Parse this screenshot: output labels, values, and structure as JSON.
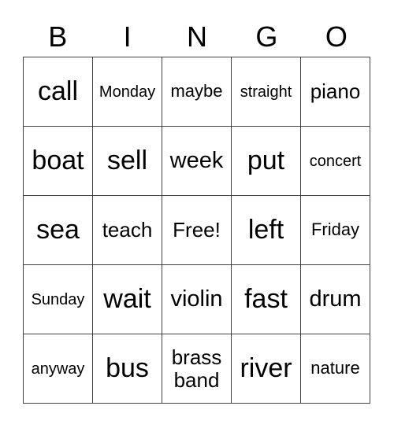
{
  "header": [
    "B",
    "I",
    "N",
    "G",
    "O"
  ],
  "rows": [
    [
      {
        "t": "call",
        "s": "s36"
      },
      {
        "t": "Monday",
        "s": "s20"
      },
      {
        "t": "maybe",
        "s": "s22"
      },
      {
        "t": "straight",
        "s": "s20"
      },
      {
        "t": "piano",
        "s": "s26"
      }
    ],
    [
      {
        "t": "boat",
        "s": "s36"
      },
      {
        "t": "sell",
        "s": "s36"
      },
      {
        "t": "week",
        "s": "s30"
      },
      {
        "t": "put",
        "s": "s36"
      },
      {
        "t": "concert",
        "s": "s20"
      }
    ],
    [
      {
        "t": "sea",
        "s": "s36"
      },
      {
        "t": "teach",
        "s": "s26"
      },
      {
        "t": "Free!",
        "s": "s26"
      },
      {
        "t": "left",
        "s": "s36"
      },
      {
        "t": "Friday",
        "s": "s22"
      }
    ],
    [
      {
        "t": "Sunday",
        "s": "s20"
      },
      {
        "t": "wait",
        "s": "s36"
      },
      {
        "t": "violin",
        "s": "s30"
      },
      {
        "t": "fast",
        "s": "s36"
      },
      {
        "t": "drum",
        "s": "s30"
      }
    ],
    [
      {
        "t": "anyway",
        "s": "s20"
      },
      {
        "t": "bus",
        "s": "s36"
      },
      {
        "t": "brass band",
        "s": "s26"
      },
      {
        "t": "river",
        "s": "s36"
      },
      {
        "t": "nature",
        "s": "s22"
      }
    ]
  ]
}
